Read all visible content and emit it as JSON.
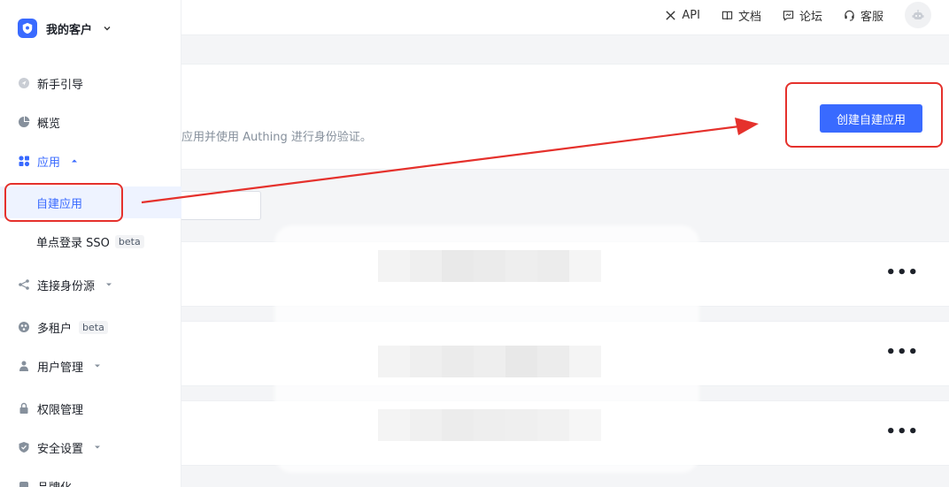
{
  "brand": {
    "name": "我的客户"
  },
  "sidebar": {
    "items": [
      {
        "label": "新手引导",
        "icon": "send-icon"
      },
      {
        "label": "概览",
        "icon": "pie-chart-icon"
      },
      {
        "label": "应用",
        "icon": "apps-icon",
        "expanded": true
      },
      {
        "label": "连接身份源",
        "icon": "share-icon"
      },
      {
        "label": "多租户",
        "icon": "tenant-icon",
        "badge": "beta"
      },
      {
        "label": "用户管理",
        "icon": "users-icon"
      },
      {
        "label": "权限管理",
        "icon": "lock-icon"
      },
      {
        "label": "安全设置",
        "icon": "shield-icon"
      },
      {
        "label": "品牌化",
        "icon": "brand-icon"
      }
    ],
    "sub_items": [
      {
        "label": "自建应用",
        "selected": true
      },
      {
        "label": "单点登录 SSO",
        "badge": "beta"
      }
    ]
  },
  "topnav": {
    "api": "API",
    "docs": "文档",
    "forum": "论坛",
    "support": "客服"
  },
  "header": {
    "description": "应用并使用 Authing 进行身份验证。",
    "create_button": "创建自建应用"
  },
  "rows": [
    {
      "more": "•••"
    },
    {
      "more": "•••"
    },
    {
      "more": "•••"
    }
  ],
  "colors": {
    "primary": "#396aff",
    "annotation_red": "#e5312c",
    "selected_bg": "#eef3ff"
  }
}
